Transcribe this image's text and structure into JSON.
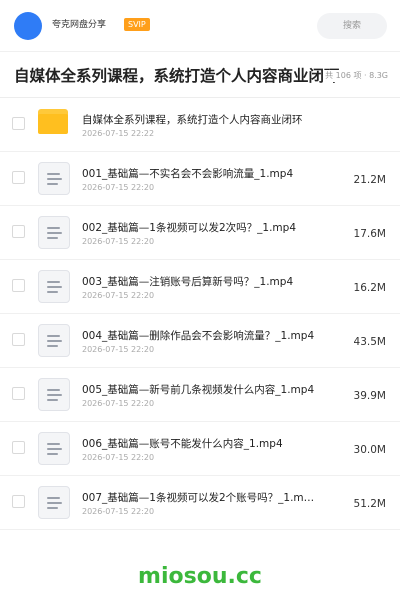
{
  "header": {
    "username": "夸克网盘分享",
    "badge": "SVIP",
    "search_label": "搜索",
    "avatar_color": "#2f7cf6"
  },
  "folder": {
    "title": "自媒体全系列课程，系统打造个人内容商业闭环",
    "meta": "共 106 项 · 8.3G"
  },
  "items": [
    {
      "type": "folder",
      "icon": "folder-icon",
      "name": "自媒体全系列课程，系统打造个人内容商业闭环",
      "date": "2026-07-15 22:22",
      "size": ""
    },
    {
      "type": "file",
      "icon": "file-icon",
      "name": "001_基础篇—不实名会不会影响流量_1.mp4",
      "date": "2026-07-15 22:20",
      "size": "21.2M"
    },
    {
      "type": "file",
      "icon": "file-icon",
      "name": "002_基础篇—1条视频可以发2次吗？_1.mp4",
      "date": "2026-07-15 22:20",
      "size": "17.6M"
    },
    {
      "type": "file",
      "icon": "file-icon",
      "name": "003_基础篇—注销账号后算新号吗？_1.mp4",
      "date": "2026-07-15 22:20",
      "size": "16.2M"
    },
    {
      "type": "file",
      "icon": "file-icon",
      "name": "004_基础篇—删除作品会不会影响流量？_1.mp4",
      "date": "2026-07-15 22:20",
      "size": "43.5M"
    },
    {
      "type": "file",
      "icon": "file-icon",
      "name": "005_基础篇—新号前几条视频发什么内容_1.mp4",
      "date": "2026-07-15 22:20",
      "size": "39.9M"
    },
    {
      "type": "file",
      "icon": "file-icon",
      "name": "006_基础篇—账号不能发什么内容_1.mp4",
      "date": "2026-07-15 22:20",
      "size": "30.0M"
    },
    {
      "type": "file",
      "icon": "file-icon",
      "name": "007_基础篇—1条视频可以发2个账号吗？_1.m…",
      "date": "2026-07-15 22:20",
      "size": "51.2M"
    }
  ],
  "watermark": "miosou.cc"
}
